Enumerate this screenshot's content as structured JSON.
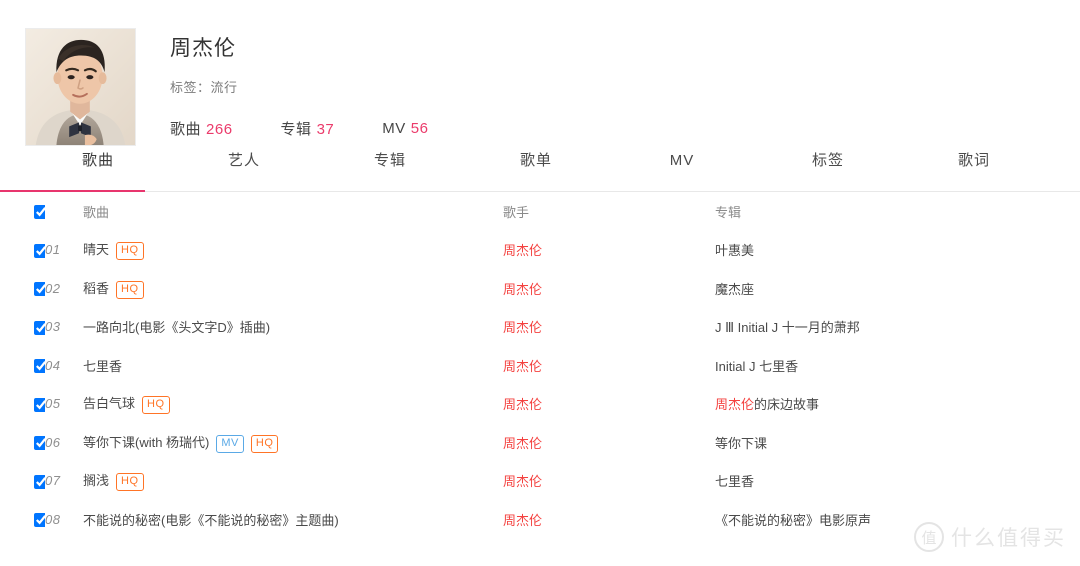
{
  "artist": {
    "name": "周杰伦",
    "tag_label": "标签：流行",
    "avatar_alt": "artist-portrait",
    "stats": [
      {
        "label": "歌曲",
        "value": "266"
      },
      {
        "label": "专辑",
        "value": "37"
      },
      {
        "label": "MV",
        "value": "56"
      }
    ]
  },
  "tabs": [
    {
      "label": "歌曲",
      "active": true
    },
    {
      "label": "艺人",
      "active": false
    },
    {
      "label": "专辑",
      "active": false
    },
    {
      "label": "歌单",
      "active": false
    },
    {
      "label": "MV",
      "active": false
    },
    {
      "label": "标签",
      "active": false
    },
    {
      "label": "歌词",
      "active": false
    }
  ],
  "table": {
    "headers": {
      "index": "",
      "title": "歌曲",
      "artist": "歌手",
      "album": "专辑"
    },
    "rows": [
      {
        "index": "01",
        "title": "晴天",
        "badges": [
          "HQ"
        ],
        "artist": "周杰伦",
        "album": "叶惠美",
        "album_highlight": "",
        "checked": true
      },
      {
        "index": "02",
        "title": "稻香",
        "badges": [
          "HQ"
        ],
        "artist": "周杰伦",
        "album": "魔杰座",
        "album_highlight": "",
        "checked": true
      },
      {
        "index": "03",
        "title": "一路向北(电影《头文字D》插曲)",
        "badges": [],
        "artist": "周杰伦",
        "album": "J Ⅲ Initial J 十一月的萧邦",
        "album_highlight": "",
        "checked": true
      },
      {
        "index": "04",
        "title": "七里香",
        "badges": [],
        "artist": "周杰伦",
        "album": "Initial J 七里香",
        "album_highlight": "",
        "checked": true
      },
      {
        "index": "05",
        "title": "告白气球",
        "badges": [
          "HQ"
        ],
        "artist": "周杰伦",
        "album": "的床边故事",
        "album_highlight": "周杰伦",
        "checked": true
      },
      {
        "index": "06",
        "title": "等你下课(with 杨瑞代)",
        "badges": [
          "MV",
          "HQ"
        ],
        "artist": "周杰伦",
        "album": "等你下课",
        "album_highlight": "",
        "checked": true
      },
      {
        "index": "07",
        "title": "搁浅",
        "badges": [
          "HQ"
        ],
        "artist": "周杰伦",
        "album": "七里香",
        "album_highlight": "",
        "checked": true
      },
      {
        "index": "08",
        "title": "不能说的秘密(电影《不能说的秘密》主题曲)",
        "badges": [],
        "artist": "周杰伦",
        "album": "《不能说的秘密》电影原声",
        "album_highlight": "",
        "checked": true
      }
    ]
  },
  "watermark": {
    "mark": "值",
    "text": "什么值得买"
  },
  "colors": {
    "accent_pink": "#e8356d",
    "artist_red": "#f4413f",
    "badge_hq": "#ff7426",
    "badge_mv": "#5aa9e6",
    "text_primary": "#4a4a4a",
    "text_muted": "#8a8a8a"
  }
}
